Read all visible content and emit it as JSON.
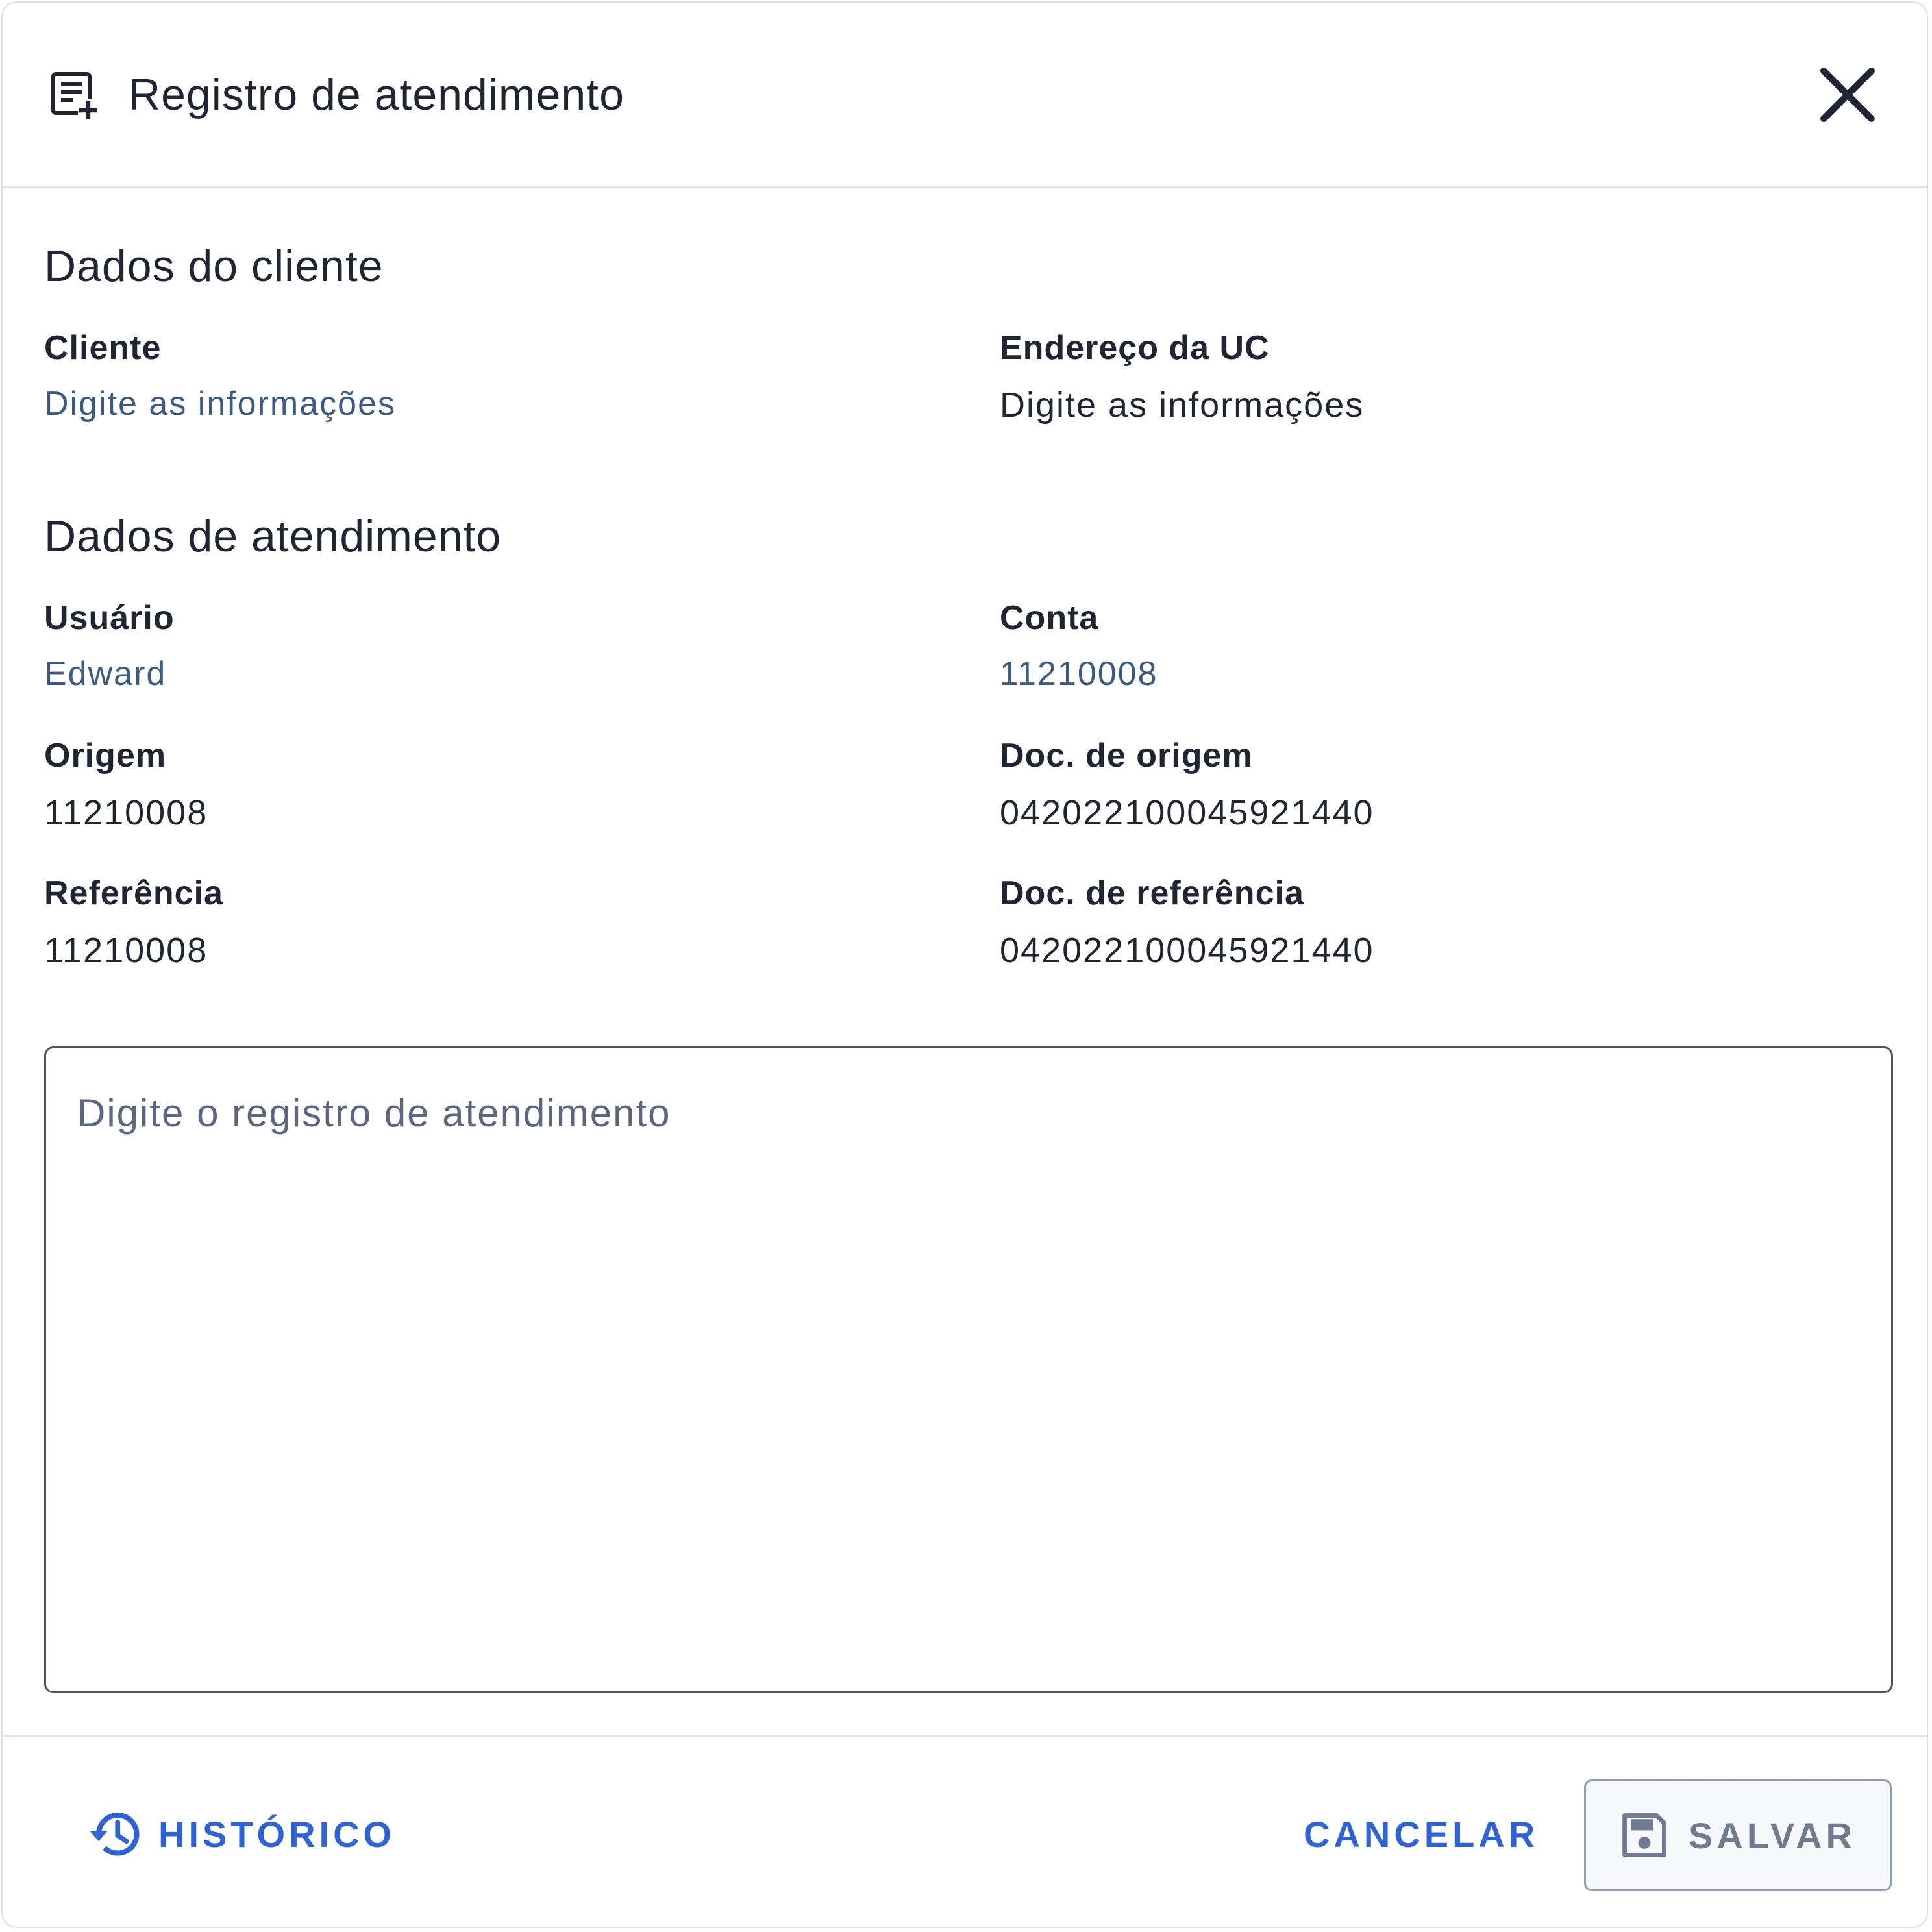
{
  "dialog": {
    "title": "Registro de atendimento",
    "title_icon": "note-add-icon",
    "close_icon": "close-icon"
  },
  "client_section": {
    "title": "Dados do cliente",
    "fields": [
      {
        "label": "Cliente",
        "value": "Digite as informações"
      },
      {
        "label": "Endereço da UC",
        "value": "Digite as informações"
      }
    ]
  },
  "service_section": {
    "title": "Dados de atendimento",
    "fields": [
      {
        "label": "Usuário",
        "value": "Edward"
      },
      {
        "label": "Conta",
        "value": "11210008"
      },
      {
        "label": "Origem",
        "value": "11210008"
      },
      {
        "label": "Doc. de origem",
        "value": "042022100045921440"
      },
      {
        "label": "Referência",
        "value": "11210008"
      },
      {
        "label": "Doc. de referência",
        "value": "042022100045921440"
      }
    ]
  },
  "record_input": {
    "placeholder": "Digite o registro de atendimento",
    "value": ""
  },
  "footer": {
    "history_label": "HISTÓRICO",
    "history_icon": "history-icon",
    "cancel_label": "CANCELAR",
    "save_label": "SALVAR",
    "save_icon": "save-icon"
  },
  "colors": {
    "primary": "#2d63d6",
    "link_value": "#3b5a85",
    "text": "#1f2533",
    "disabled": "#707a90"
  }
}
